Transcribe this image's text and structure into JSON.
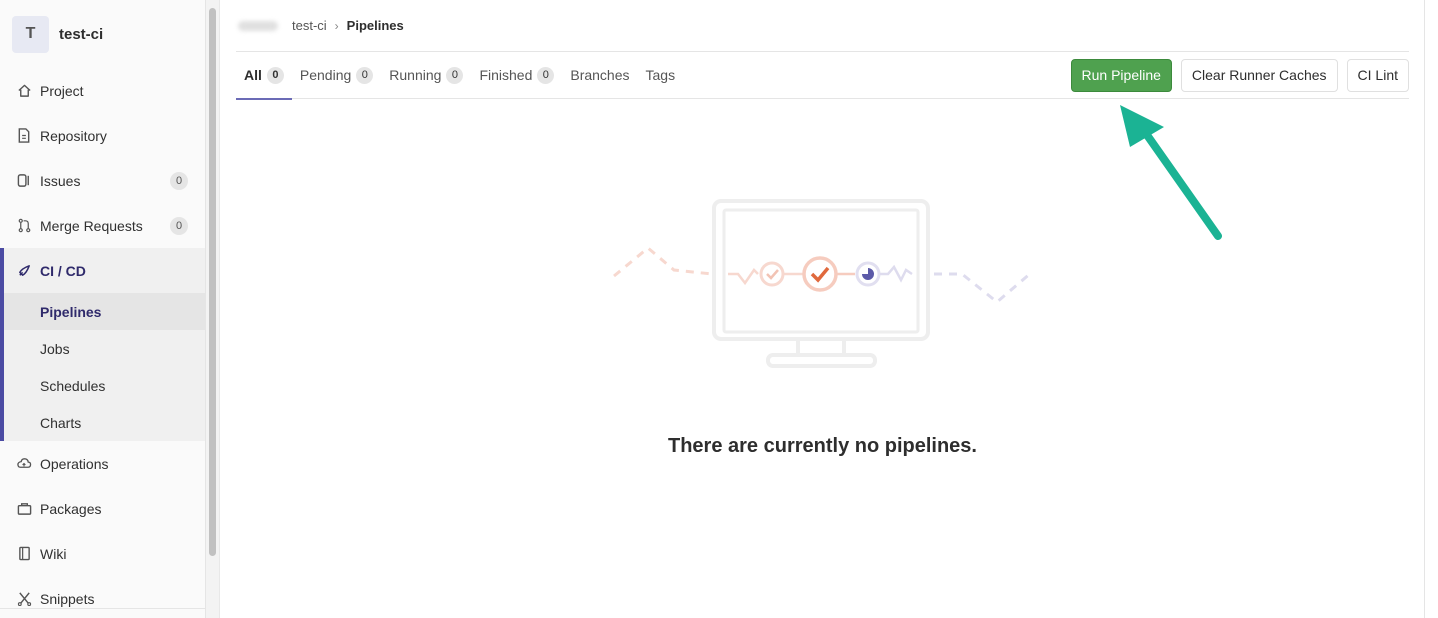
{
  "project": {
    "avatar_letter": "T",
    "name": "test-ci"
  },
  "sidebar": {
    "items": [
      {
        "label": "Project",
        "icon": "home-icon"
      },
      {
        "label": "Repository",
        "icon": "document-icon"
      },
      {
        "label": "Issues",
        "icon": "issues-icon",
        "count": "0"
      },
      {
        "label": "Merge Requests",
        "icon": "merge-request-icon",
        "count": "0"
      }
    ],
    "cicd": {
      "label": "CI / CD",
      "icon": "rocket-icon",
      "subitems": [
        "Pipelines",
        "Jobs",
        "Schedules",
        "Charts"
      ],
      "active": "Pipelines"
    },
    "items_after": [
      {
        "label": "Operations",
        "icon": "cloud-icon"
      },
      {
        "label": "Packages",
        "icon": "package-icon"
      },
      {
        "label": "Wiki",
        "icon": "book-icon"
      },
      {
        "label": "Snippets",
        "icon": "scissors-icon"
      }
    ]
  },
  "breadcrumb": {
    "project": "test-ci",
    "current": "Pipelines"
  },
  "tabs": [
    {
      "label": "All",
      "count": "0",
      "active": true
    },
    {
      "label": "Pending",
      "count": "0"
    },
    {
      "label": "Running",
      "count": "0"
    },
    {
      "label": "Finished",
      "count": "0"
    },
    {
      "label": "Branches"
    },
    {
      "label": "Tags"
    }
  ],
  "buttons": {
    "run": "Run Pipeline",
    "clear": "Clear Runner Caches",
    "lint": "CI Lint"
  },
  "empty_state": {
    "title": "There are currently no pipelines."
  },
  "colors": {
    "run_button": "#4fa14f",
    "active_accent": "#4b4ba3",
    "annotation_arrow": "#1bb394"
  }
}
